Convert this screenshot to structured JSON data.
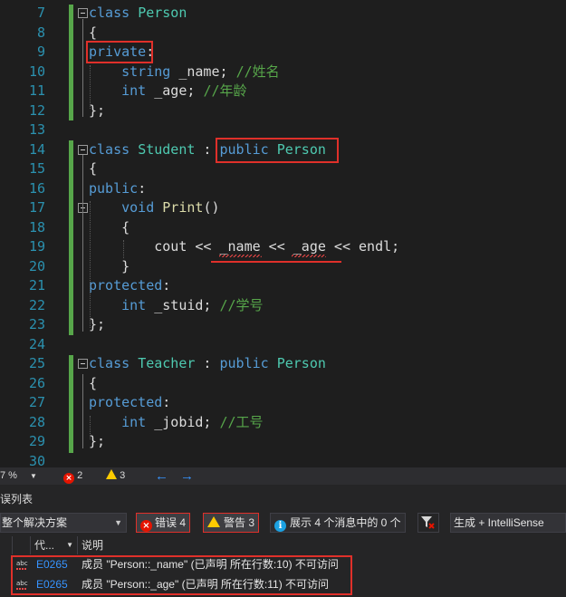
{
  "editor": {
    "lines": [
      {
        "n": "7",
        "tokens": [
          {
            "t": "class ",
            "c": "kw"
          },
          {
            "t": "Person",
            "c": "ty"
          }
        ]
      },
      {
        "n": "8",
        "tokens": [
          {
            "t": "{",
            "c": "va"
          }
        ]
      },
      {
        "n": "9",
        "tokens": [
          {
            "t": "private",
            "c": "kw"
          },
          {
            "t": ":",
            "c": "va"
          }
        ]
      },
      {
        "n": "10",
        "tokens": [
          {
            "t": "    string ",
            "c": "kw"
          },
          {
            "t": "_name; ",
            "c": "va"
          },
          {
            "t": "//姓名",
            "c": "cm"
          }
        ]
      },
      {
        "n": "11",
        "tokens": [
          {
            "t": "    int ",
            "c": "kw"
          },
          {
            "t": "_age; ",
            "c": "va"
          },
          {
            "t": "//年龄",
            "c": "cm"
          }
        ]
      },
      {
        "n": "12",
        "tokens": [
          {
            "t": "};",
            "c": "va"
          }
        ]
      },
      {
        "n": "13",
        "tokens": []
      },
      {
        "n": "14",
        "tokens": [
          {
            "t": "class ",
            "c": "kw"
          },
          {
            "t": "Student",
            "c": "ty"
          },
          {
            "t": " : ",
            "c": "va"
          },
          {
            "t": "public ",
            "c": "kw"
          },
          {
            "t": "Person",
            "c": "ty"
          }
        ]
      },
      {
        "n": "15",
        "tokens": [
          {
            "t": "{",
            "c": "va"
          }
        ]
      },
      {
        "n": "16",
        "tokens": [
          {
            "t": "public",
            "c": "kw"
          },
          {
            "t": ":",
            "c": "va"
          }
        ]
      },
      {
        "n": "17",
        "tokens": [
          {
            "t": "    void ",
            "c": "kw"
          },
          {
            "t": "Print",
            "c": "fn"
          },
          {
            "t": "()",
            "c": "va"
          }
        ]
      },
      {
        "n": "18",
        "tokens": [
          {
            "t": "    {",
            "c": "va"
          }
        ]
      },
      {
        "n": "19",
        "tokens": [
          {
            "t": "        cout << _name << _age << endl;",
            "c": "va"
          }
        ]
      },
      {
        "n": "20",
        "tokens": [
          {
            "t": "    }",
            "c": "va"
          }
        ]
      },
      {
        "n": "21",
        "tokens": [
          {
            "t": "protected",
            "c": "kw"
          },
          {
            "t": ":",
            "c": "va"
          }
        ]
      },
      {
        "n": "22",
        "tokens": [
          {
            "t": "    int ",
            "c": "kw"
          },
          {
            "t": "_stuid; ",
            "c": "va"
          },
          {
            "t": "//学号",
            "c": "cm"
          }
        ]
      },
      {
        "n": "23",
        "tokens": [
          {
            "t": "};",
            "c": "va"
          }
        ]
      },
      {
        "n": "24",
        "tokens": []
      },
      {
        "n": "25",
        "tokens": [
          {
            "t": "class ",
            "c": "kw"
          },
          {
            "t": "Teacher",
            "c": "ty"
          },
          {
            "t": " : ",
            "c": "va"
          },
          {
            "t": "public ",
            "c": "kw"
          },
          {
            "t": "Person",
            "c": "ty"
          }
        ]
      },
      {
        "n": "26",
        "tokens": [
          {
            "t": "{",
            "c": "va"
          }
        ]
      },
      {
        "n": "27",
        "tokens": [
          {
            "t": "protected",
            "c": "kw"
          },
          {
            "t": ":",
            "c": "va"
          }
        ]
      },
      {
        "n": "28",
        "tokens": [
          {
            "t": "    int ",
            "c": "kw"
          },
          {
            "t": "_jobid; ",
            "c": "va"
          },
          {
            "t": "//工号",
            "c": "cm"
          }
        ]
      },
      {
        "n": "29",
        "tokens": [
          {
            "t": "};",
            "c": "va"
          }
        ]
      },
      {
        "n": "30",
        "tokens": []
      }
    ]
  },
  "status": {
    "zoom": "7 %",
    "errors": "2",
    "warnings": "3",
    "nav_back": "←",
    "nav_forward": "→"
  },
  "error_list": {
    "title": "误列表",
    "scope": "整个解决方案",
    "errors_btn": "错误 4",
    "warnings_btn": "警告 3",
    "messages_btn": "展示 4 个消息中的 0 个",
    "build_filter": "生成 + IntelliSense",
    "columns": {
      "code": "代...",
      "description": "说明"
    },
    "rows": [
      {
        "code": "E0265",
        "description": "成员 \"Person::_name\" (已声明 所在行数:10) 不可访问"
      },
      {
        "code": "E0265",
        "description": "成员 \"Person::_age\" (已声明 所在行数:11) 不可访问"
      }
    ]
  }
}
